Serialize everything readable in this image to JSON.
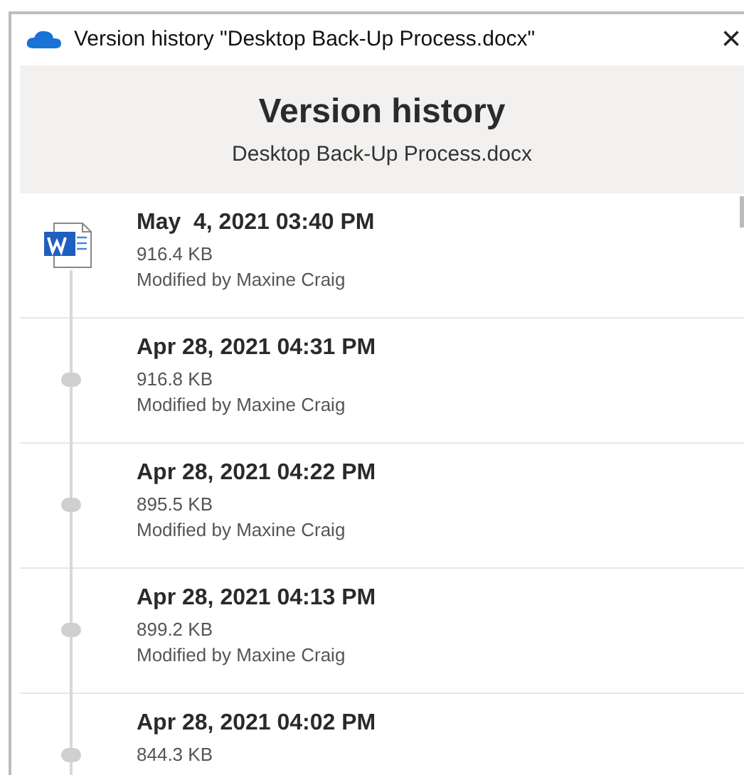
{
  "window": {
    "title": "Version history \"Desktop Back-Up Process.docx\"",
    "close": "×"
  },
  "header": {
    "title": "Version history",
    "file": "Desktop Back-Up Process.docx"
  },
  "versions": [
    {
      "kind": "current",
      "date": "May  4, 2021 03:40 PM",
      "size": "916.4 KB",
      "modified": "Modified by Maxine Craig"
    },
    {
      "kind": "older",
      "date": "Apr 28, 2021 04:31 PM",
      "size": "916.8 KB",
      "modified": "Modified by Maxine Craig"
    },
    {
      "kind": "older",
      "date": "Apr 28, 2021 04:22 PM",
      "size": "895.5 KB",
      "modified": "Modified by Maxine Craig"
    },
    {
      "kind": "older",
      "date": "Apr 28, 2021 04:13 PM",
      "size": "899.2 KB",
      "modified": "Modified by Maxine Craig"
    },
    {
      "kind": "older",
      "date": "Apr 28, 2021 04:02 PM",
      "size": "844.3 KB"
    }
  ]
}
